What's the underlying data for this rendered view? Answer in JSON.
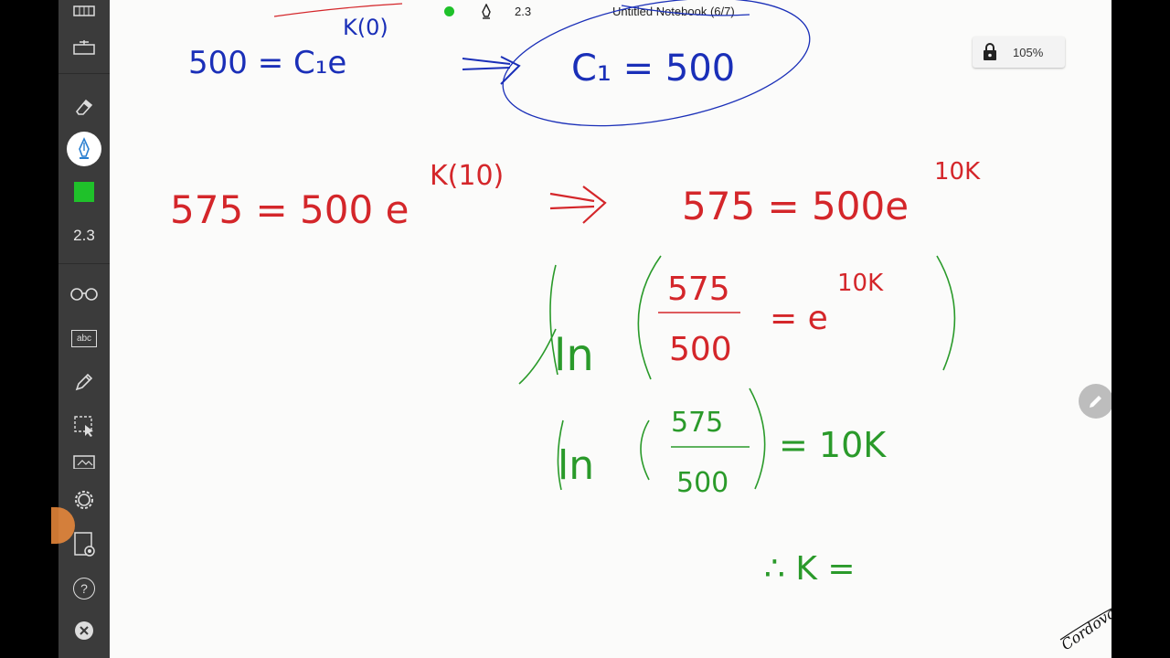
{
  "status_bar": {
    "version_text": "2.3",
    "notebook_title": "Untitled Notebook (6/7)"
  },
  "toolbar": {
    "version_label": "2.3",
    "items": [
      {
        "name": "grid-icon",
        "interactable": true
      },
      {
        "name": "ruler-icon",
        "interactable": true
      },
      {
        "name": "eraser-icon",
        "interactable": true
      },
      {
        "name": "pen-icon",
        "interactable": true
      },
      {
        "name": "color-swatch",
        "interactable": true
      },
      {
        "name": "glasses-icon",
        "interactable": true
      },
      {
        "name": "text-box-icon",
        "interactable": true
      },
      {
        "name": "highlighter-icon",
        "interactable": true
      },
      {
        "name": "selection-icon",
        "interactable": true
      },
      {
        "name": "image-icon",
        "interactable": true
      },
      {
        "name": "settings-gear-icon",
        "interactable": true
      },
      {
        "name": "page-settings-icon",
        "interactable": true
      },
      {
        "name": "help-icon",
        "interactable": true
      },
      {
        "name": "close-icon",
        "interactable": true
      }
    ],
    "abc_label": "abc",
    "help_label": "?",
    "active_color": "#1fc12a"
  },
  "zoom": {
    "level": "105%"
  },
  "colors": {
    "toolbar_bg": "#3b3b3b",
    "canvas_bg": "#fbfbfa",
    "ink_red": "#d4262a",
    "ink_green": "#2a9a2a",
    "ink_blue": "#1a2fb8",
    "status_dot": "#1fc12a"
  },
  "handwriting": {
    "line1_left": "500 = C₁e",
    "line1_exp": "K(0)",
    "line1_right": "C₁ = 500",
    "line2_left": "575 = 500 e",
    "line2_left_exp": "K(10)",
    "line2_right": "575 = 500e",
    "line2_right_exp": "10K",
    "line3_ln": "ln",
    "line3_num": "575",
    "line3_den": "500",
    "line3_eq": "= e",
    "line3_exp": "10K",
    "line4_ln": "ln",
    "line4_num": "575",
    "line4_den": "500",
    "line4_eq": "= 10K",
    "line5": "∴ K =",
    "signature": "Cordova"
  }
}
